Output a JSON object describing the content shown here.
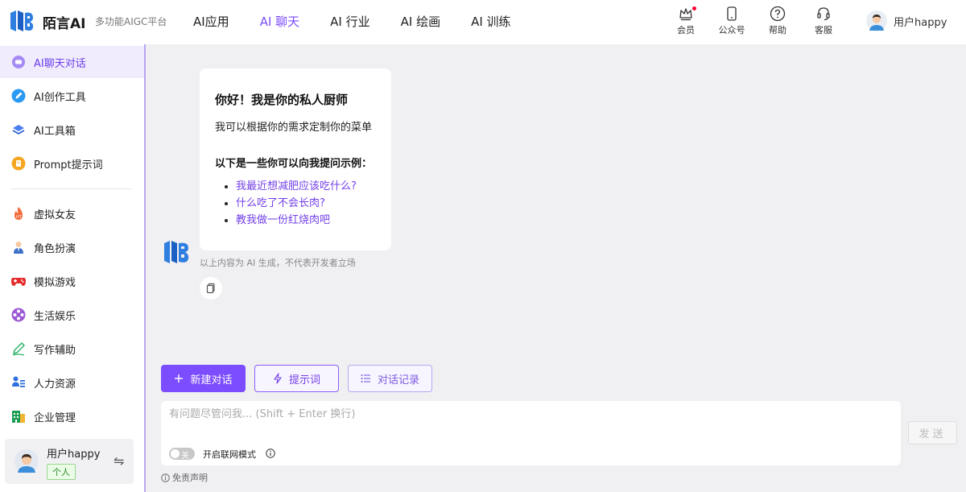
{
  "header": {
    "brand": "陌言AI",
    "tagline": "多功能AIGC平台",
    "nav": [
      {
        "label": "AI应用",
        "active": false
      },
      {
        "label": "AI 聊天",
        "active": true
      },
      {
        "label": "AI 行业",
        "active": false
      },
      {
        "label": "AI 绘画",
        "active": false
      },
      {
        "label": "AI 训练",
        "active": false
      }
    ],
    "icons": [
      {
        "icon": "crown-icon",
        "label": "会员"
      },
      {
        "icon": "phone-icon",
        "label": "公众号"
      },
      {
        "icon": "help-icon",
        "label": "帮助"
      },
      {
        "icon": "headset-icon",
        "label": "客服"
      }
    ],
    "user": "用户happy"
  },
  "sidebar": {
    "items": [
      {
        "icon": "chat-bubble-icon",
        "label": "AI聊天对话",
        "active": true
      },
      {
        "icon": "pen-icon",
        "label": "AI创作工具"
      },
      {
        "icon": "layers-icon",
        "label": "AI工具箱"
      },
      {
        "icon": "prompt-icon",
        "label": "Prompt提示词"
      },
      {
        "icon": "fire-icon",
        "label": "虚拟女友"
      },
      {
        "icon": "person-icon",
        "label": "角色扮演"
      },
      {
        "icon": "gamepad-icon",
        "label": "模拟游戏"
      },
      {
        "icon": "film-reel-icon",
        "label": "生活娱乐"
      },
      {
        "icon": "pencil-icon",
        "label": "写作辅助"
      },
      {
        "icon": "people-icon",
        "label": "人力资源"
      },
      {
        "icon": "building-icon",
        "label": "企业管理"
      }
    ],
    "user_card": {
      "name": "用户happy",
      "badge": "个人",
      "swap_symbol": "⇋"
    }
  },
  "chat": {
    "welcome_title": "你好！我是你的私人厨师",
    "welcome_sub": "我可以根据你的需求定制你的菜单",
    "hint_title": "以下是一些你可以向我提问示例：",
    "examples": [
      "我最近想减肥应该吃什么?",
      "什么吃了不会长肉?",
      "教我做一份红烧肉吧"
    ],
    "ai_disclaimer": "以上内容为 AI 生成，不代表开发者立场"
  },
  "actions": {
    "new_chat": "新建对话",
    "prompts": "提示词",
    "history": "对话记录"
  },
  "input": {
    "placeholder": "有问题尽管问我... (Shift + Enter 换行)",
    "value": "",
    "toggle_state": "关",
    "web_mode_label": "开启联网模式",
    "send": "发送"
  },
  "footer": {
    "statement": "免责声明"
  },
  "colors": {
    "accent": "#7c4dff",
    "link": "#7340e8",
    "background": "#f0f0f3"
  }
}
